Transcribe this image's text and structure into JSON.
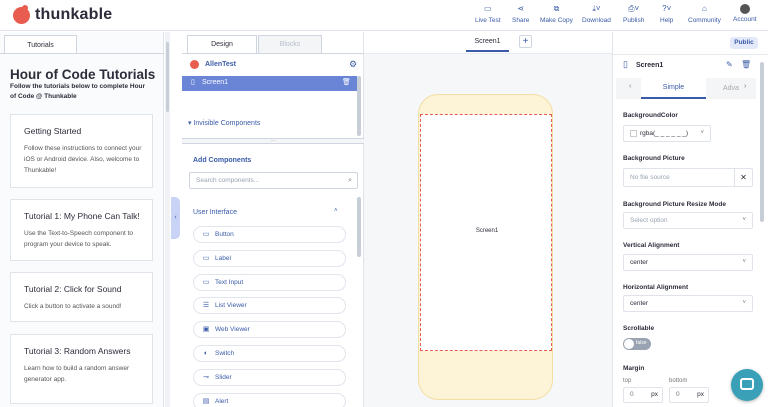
{
  "app": {
    "logo": "thunkable"
  },
  "nav": [
    {
      "label": "Live Test",
      "icon": "live-test-icon",
      "glyph": "▭"
    },
    {
      "label": "Share",
      "icon": "share-icon",
      "glyph": "⋖"
    },
    {
      "label": "Make Copy",
      "icon": "copy-icon",
      "glyph": "⧉"
    },
    {
      "label": "Download",
      "icon": "download-icon",
      "glyph": "⤓˅"
    },
    {
      "label": "Publish",
      "icon": "publish-icon",
      "glyph": "⎙˅"
    },
    {
      "label": "Help",
      "icon": "help-icon",
      "glyph": "?˅"
    },
    {
      "label": "Community",
      "icon": "community-icon",
      "glyph": "⌂"
    },
    {
      "label": "Account",
      "icon": "account-icon",
      "glyph": "˅"
    }
  ],
  "tutorials": {
    "tab": "Tutorials",
    "title": "Hour of Code Tutorials",
    "subtitle": "Follow the tutorials below to complete Hour of Code @ Thunkable",
    "cards": [
      {
        "title": "Getting Started",
        "desc": "Follow these instructions to connect your iOS or Android device. Also, welcome to Thunkable!"
      },
      {
        "title": "Tutorial 1: My Phone Can Talk!",
        "desc": "Use the Text-to-Speech component to program your device to speak."
      },
      {
        "title": "Tutorial 2: Click for Sound",
        "desc": "Click a button to activate a sound!"
      },
      {
        "title": "Tutorial 3: Random Answers",
        "desc": "Learn how to build a random answer generator app."
      }
    ]
  },
  "editor": {
    "tabs": [
      "Design",
      "Blocks"
    ],
    "project": "AllenTest",
    "screen_item": "Screen1",
    "invisible_header": "Invisible Components",
    "add_header": "Add Components",
    "search_placeholder": "Search components...",
    "category": "User Interface",
    "components": [
      {
        "label": "Button",
        "icon": "button-icon",
        "glyph": "▭"
      },
      {
        "label": "Label",
        "icon": "label-icon",
        "glyph": "▭"
      },
      {
        "label": "Text Input",
        "icon": "text-input-icon",
        "glyph": "▭"
      },
      {
        "label": "List Viewer",
        "icon": "list-viewer-icon",
        "glyph": "☰"
      },
      {
        "label": "Web Viewer",
        "icon": "web-viewer-icon",
        "glyph": "▣"
      },
      {
        "label": "Switch",
        "icon": "switch-icon",
        "glyph": "◐"
      },
      {
        "label": "Slider",
        "icon": "slider-icon",
        "glyph": "⊸"
      },
      {
        "label": "Alert",
        "icon": "alert-icon",
        "glyph": "▤"
      }
    ]
  },
  "canvas": {
    "tab": "Screen1",
    "add": "+",
    "screen_label": "Screen1"
  },
  "props": {
    "public": "Public",
    "title": "Screen1",
    "tabs": [
      "Simple",
      "Adva"
    ],
    "fields": [
      {
        "label": "BackgroundColor",
        "value": "rgba(_ _ _ _ _ _)"
      },
      {
        "label": "Background Picture",
        "value": "No file source"
      },
      {
        "label": "Background Picture Resize Mode",
        "value": "Select option"
      },
      {
        "label": "Vertical Alignment",
        "value": "center"
      },
      {
        "label": "Horizontal Alignment",
        "value": "center"
      },
      {
        "label": "Scrollable",
        "value": "false"
      },
      {
        "label": "Margin",
        "value": ""
      }
    ],
    "margin": {
      "top_label": "top",
      "bottom_label": "bottom",
      "top_value": "0",
      "bottom_value": "0",
      "unit": "px"
    }
  },
  "colors": {
    "accent": "#3a5ba8",
    "brand": "#e85d4f",
    "selected_row": "#6a84d6",
    "phone": "#fdf3d6",
    "chat": "#3aa0b8"
  }
}
